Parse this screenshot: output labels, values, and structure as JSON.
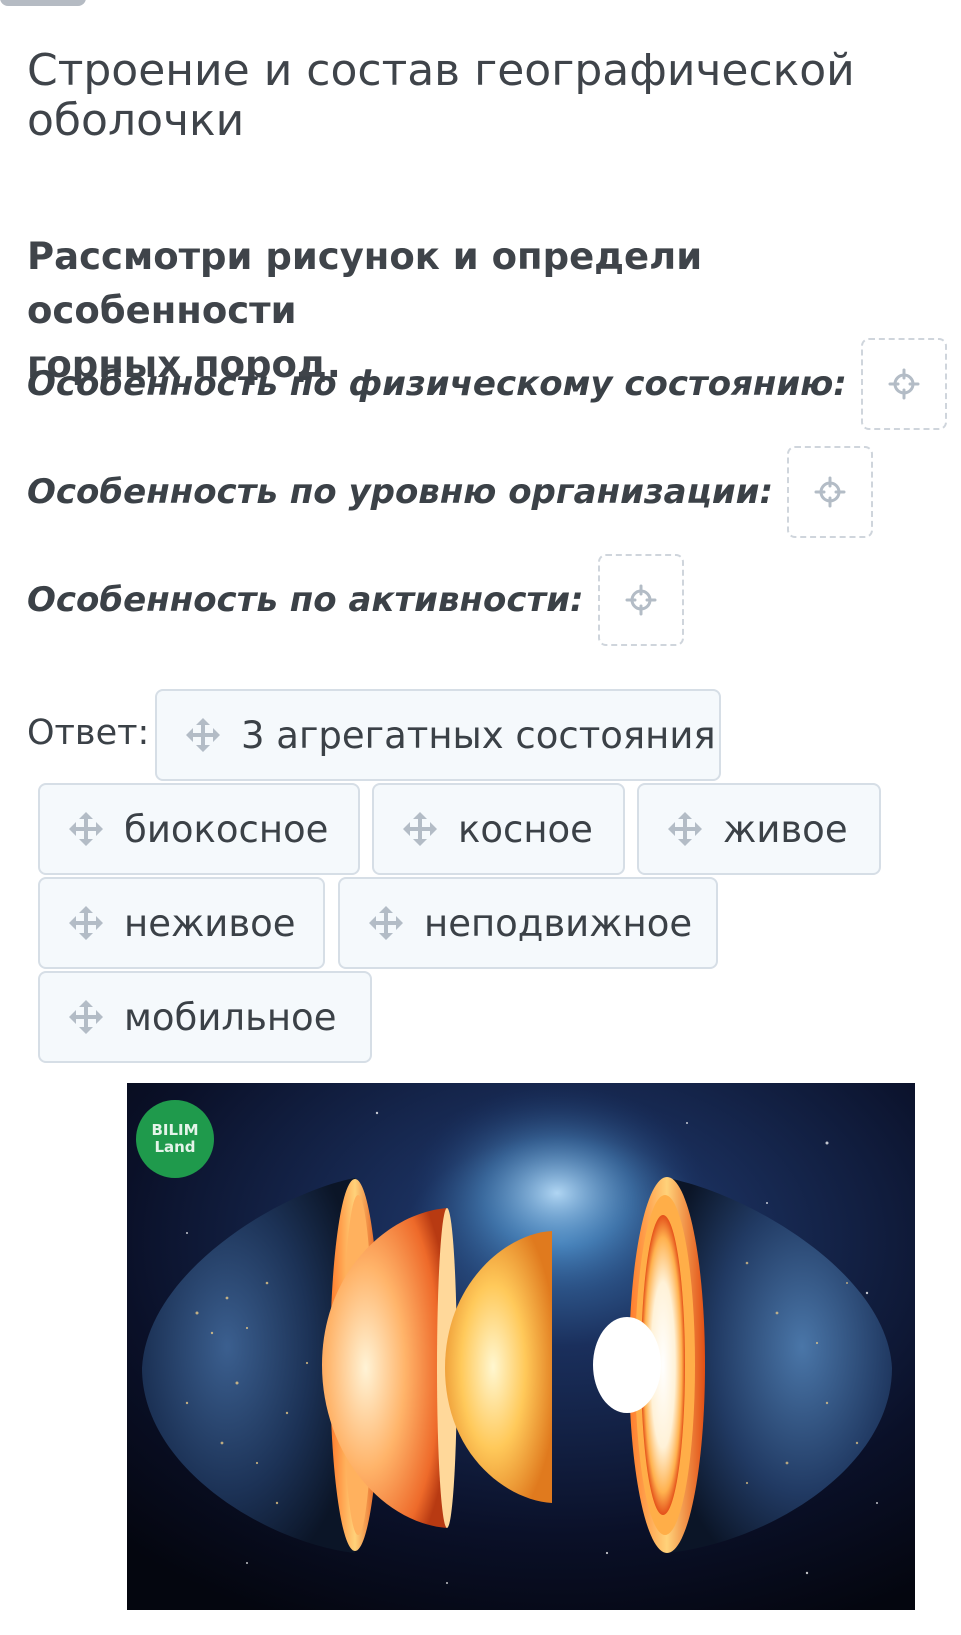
{
  "header": {
    "title_line1": "Строение и состав географической",
    "title_line2": "оболочки"
  },
  "question": {
    "line1": "Рассмотри рисунок и определи особенности",
    "line2": "горных пород."
  },
  "rows": [
    {
      "label": "Особенность по физическому состоянию:"
    },
    {
      "label": "Особенность по уровню организации:"
    },
    {
      "label": "Особенность по активности:"
    }
  ],
  "answer": {
    "label": "Ответ:",
    "options": [
      "3 агрегатных состояния",
      "биокосное",
      "косное",
      "живое",
      "неживое",
      "неподвижное",
      "мобильное"
    ]
  },
  "figure": {
    "logo_line1": "BILIM",
    "logo_line2": "Land"
  },
  "icons": {
    "drop_target": "crosshair-icon",
    "drag_handle": "move-icon"
  },
  "colors": {
    "chip_bg": "#f5f9fc",
    "chip_border": "#d6dee6",
    "icon": "#b3bcc6",
    "text": "#3b4147",
    "logo_green": "#1f9a4c"
  }
}
